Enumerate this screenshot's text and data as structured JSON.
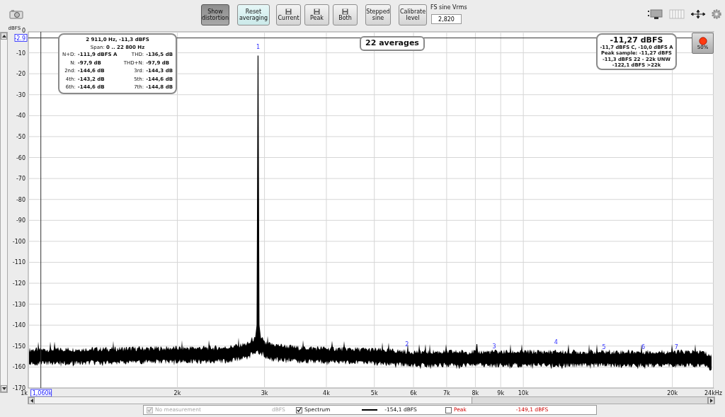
{
  "toolbar": {
    "buttons": [
      {
        "label": "Show distortion",
        "kind": "toggle",
        "pressed": true
      },
      {
        "label": "Reset averaging",
        "kind": "action"
      },
      {
        "label": "Current",
        "kind": "save"
      },
      {
        "label": "Peak",
        "kind": "save"
      },
      {
        "label": "Both",
        "kind": "save"
      },
      {
        "label": "Stepped sine",
        "kind": "plain"
      },
      {
        "label": "Calibrate level",
        "kind": "plain"
      }
    ],
    "fs_sine": {
      "label": "FS sine Vrms",
      "value": "2,820"
    }
  },
  "chart": {
    "y_unit": "dBFS",
    "y_ticks": [
      "0",
      "-10",
      "-20",
      "-30",
      "-40",
      "-50",
      "-60",
      "-70",
      "-80",
      "-90",
      "-100",
      "-110",
      "-120",
      "-130",
      "-140",
      "-150",
      "-160",
      "-170"
    ],
    "x_ticks": [
      "1k",
      "2k",
      "3k",
      "4k",
      "5k",
      "6k",
      "7k",
      "8k",
      "9k",
      "10k",
      "20k",
      "24kHz"
    ],
    "cursor": {
      "level": "-2.9",
      "frequency": "1,060k"
    },
    "harmonic_markers": [
      "1",
      "2",
      "3",
      "4",
      "5",
      "6",
      "7"
    ]
  },
  "distortion_readout": {
    "title": "2 911,0 Hz, -11,3 dBFS",
    "span": "Span: **0 .. 22 800 Hz**",
    "rows": [
      {
        "label": "N+D:",
        "value": "-111,9 dBFS A"
      },
      {
        "label": "THD:",
        "value": "-136,5 dB"
      },
      {
        "label": "N:",
        "value": "-97,9 dB"
      },
      {
        "label": "THD+N:",
        "value": "-97,9 dB"
      },
      {
        "label": "2nd:",
        "value": "-144,6 dB"
      },
      {
        "label": "3rd:",
        "value": "-144,3 dB"
      },
      {
        "label": "4th:",
        "value": "-143,2 dB"
      },
      {
        "label": "5th:",
        "value": "-144,6 dB"
      },
      {
        "label": "6th:",
        "value": "-144,6 dB"
      },
      {
        "label": "7th:",
        "value": "-144,8 dB"
      }
    ]
  },
  "averages": "22 averages",
  "level_readout": {
    "main": "-11,27 dBFS",
    "lines": [
      "-11,7 dBFS C, -10,0 dBFS A",
      "Peak sample: -11,27 dBFS",
      "-11,3 dBFS 22 - 22k UNW",
      "-122,1 dBFS >22k"
    ]
  },
  "record_button": {
    "label": "50%"
  },
  "legend": [
    {
      "kind": "none",
      "label": "No measurement",
      "reading": "dBFS",
      "checked": true,
      "disabled": true
    },
    {
      "kind": "series",
      "label": "Spectrum",
      "reading": "-154,1 dBFS",
      "checked": true,
      "disabled": false
    },
    {
      "kind": "peak",
      "label": "Peak",
      "reading": "-149,1 dBFS",
      "checked": false,
      "disabled": false
    }
  ]
}
